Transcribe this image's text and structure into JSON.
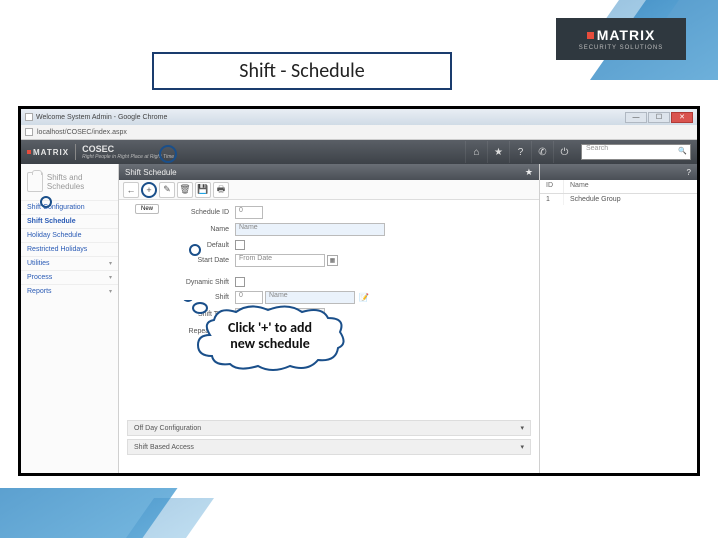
{
  "slide": {
    "title": "Shift - Schedule",
    "logo_brand": "MATRIX",
    "logo_sub": "SECURITY SOLUTIONS"
  },
  "chrome": {
    "tab_title": "Welcome System Admin - Google Chrome",
    "url": "localhost/COSEC/index.aspx"
  },
  "app": {
    "brand": "MATRIX",
    "product": "COSEC",
    "tagline": "Right People in Right Place at Right Time",
    "search_placeholder": "Search"
  },
  "sidebar": {
    "header": "Shifts and Schedules",
    "items": [
      {
        "label": "Shift Configuration",
        "expandable": false
      },
      {
        "label": "Shift Schedule",
        "expandable": false,
        "active": true
      },
      {
        "label": "Holiday Schedule",
        "expandable": false
      },
      {
        "label": "Restricted Holidays",
        "expandable": false
      },
      {
        "label": "Utilities",
        "expandable": true
      },
      {
        "label": "Process",
        "expandable": true
      },
      {
        "label": "Reports",
        "expandable": true
      }
    ]
  },
  "panel": {
    "title": "Shift Schedule",
    "new_tooltip": "New",
    "fields": {
      "schedule_id_label": "Schedule ID",
      "schedule_id_value": "0",
      "name_label": "Name",
      "name_placeholder": "Name",
      "default_label": "Default",
      "start_date_label": "Start Date",
      "start_date_placeholder": "From Date",
      "dynamic_shift_label": "Dynamic Shift",
      "shift_label": "Shift",
      "shift_code": "0",
      "shift_name_placeholder": "Name",
      "shift_type_label": "Shift Type",
      "repeat_days_label": "Repeat Days"
    },
    "sections": {
      "off_day": "Off Day Configuration",
      "shift_based": "Shift Based Access"
    }
  },
  "rightpanel": {
    "col_id": "ID",
    "col_name": "Name",
    "rows": [
      {
        "id": "1",
        "name": "Schedule Group"
      }
    ]
  },
  "callout": {
    "text_line1": "Click '+' to add",
    "text_line2": "new schedule"
  }
}
